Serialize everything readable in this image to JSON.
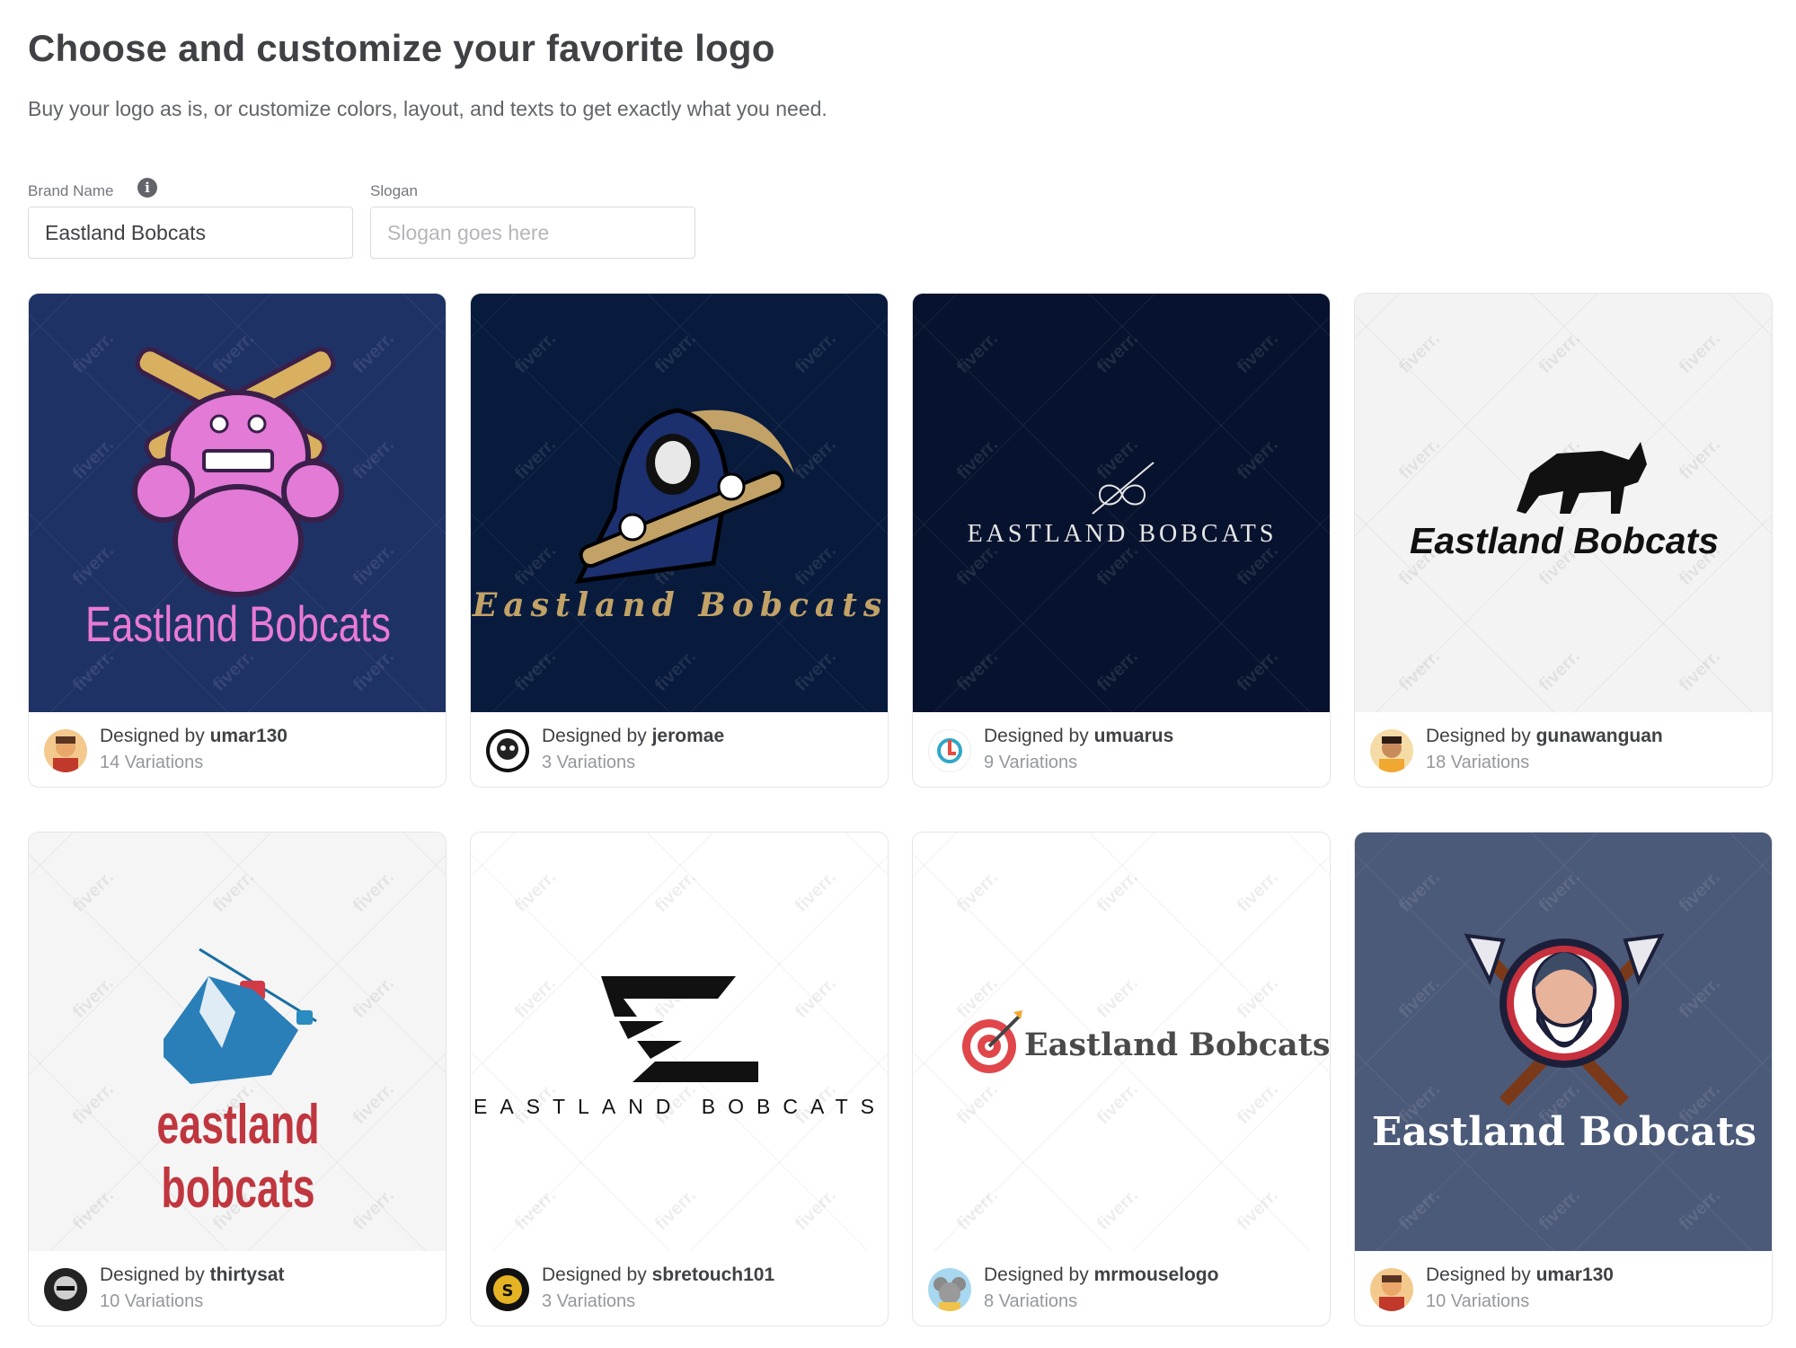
{
  "header": {
    "title": "Choose and customize your favorite logo",
    "subtitle": "Buy your logo as is, or customize colors, layout, and texts to get exactly what you need."
  },
  "form": {
    "brand_label": "Brand Name",
    "brand_value": "Eastland Bobcats",
    "slogan_label": "Slogan",
    "slogan_placeholder": "Slogan goes here",
    "info_icon": "info-icon"
  },
  "watermark_text": "fiverr.",
  "cards": [
    {
      "logo_text": "Eastland Bobcats",
      "designer_prefix": "Designed by",
      "designer": "umar130",
      "variations": "14 Variations",
      "bg": "#1f3266",
      "text_color": "#e97ad3",
      "icon": "pink-monster-baseball-icon"
    },
    {
      "logo_text": "Eastland Bobcats",
      "designer_prefix": "Designed by",
      "designer": "jeromae",
      "variations": "3 Variations",
      "bg": "#081b3d",
      "text_color": "#c2a266",
      "icon": "grim-reaper-baseball-icon"
    },
    {
      "logo_text": "EASTLAND BOBCATS",
      "designer_prefix": "Designed by",
      "designer": "umuarus",
      "variations": "9 Variations",
      "bg": "#07132e",
      "text_color": "#e6e6e6",
      "icon": "infinity-line-icon"
    },
    {
      "logo_text": "Eastland Bobcats",
      "designer_prefix": "Designed by",
      "designer": "gunawanguan",
      "variations": "18 Variations",
      "bg": "#f2f3f2",
      "text_color": "#111111",
      "icon": "bull-icon"
    },
    {
      "logo_text": "eastland bobcats",
      "designer_prefix": "Designed by",
      "designer": "thirtysat",
      "variations": "10 Variations",
      "bg": "#f5f5f5",
      "text_color": "#c0363f",
      "icon": "cable-car-mountain-icon"
    },
    {
      "logo_text": "EASTLAND BOBCATS",
      "designer_prefix": "Designed by",
      "designer": "sbretouch101",
      "variations": "3 Variations",
      "bg": "#ffffff",
      "text_color": "#111111",
      "icon": "letter-e-icon"
    },
    {
      "logo_text": "Eastland Bobcats",
      "designer_prefix": "Designed by",
      "designer": "mrmouselogo",
      "variations": "8 Variations",
      "bg": "#ffffff",
      "text_color": "#4a4a4a",
      "icon": "target-arrow-icon"
    },
    {
      "logo_text": "Eastland Bobcats",
      "designer_prefix": "Designed by",
      "designer": "umar130",
      "variations": "10 Variations",
      "bg": "#4c5a79",
      "text_color": "#ffffff",
      "icon": "viking-axes-icon"
    }
  ]
}
